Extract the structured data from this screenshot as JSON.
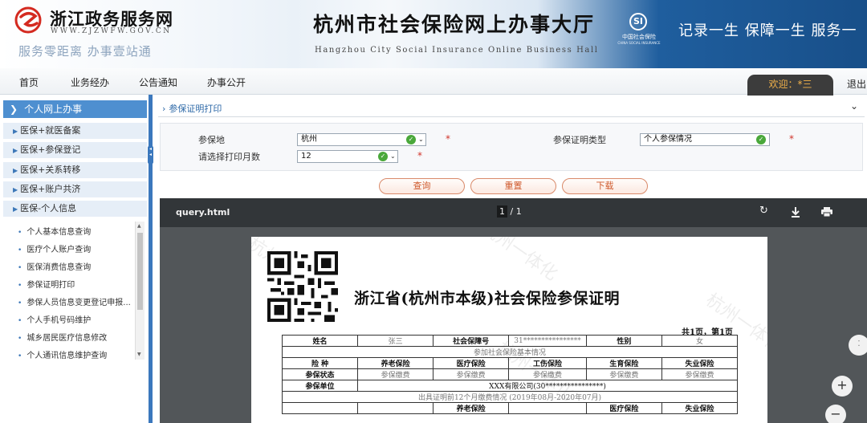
{
  "header": {
    "site_name": "浙江政务服务网",
    "site_url": "WWW.ZJZWFW.GOV.CN",
    "slogan": "服务零距离 办事壹站通",
    "title": "杭州市社会保险网上办事大厅",
    "subtitle": "Hangzhou City Social Insurance Online Business Hall",
    "si_logo_text": "中国社会保险",
    "si_logo_en": "CHINA SOCIAL INSURANCE",
    "motto": "记录一生 保障一生 服务一"
  },
  "nav": {
    "items": [
      "首页",
      "业务经办",
      "公告通知",
      "办事公开"
    ],
    "welcome": "欢迎：*三",
    "logout": "退出>"
  },
  "sidebar": {
    "head": "个人网上办事",
    "groups": [
      "医保+就医备案",
      "医保+参保登记",
      "医保+关系转移",
      "医保+账户共济",
      "医保-个人信息"
    ],
    "subitems": [
      "个人基本信息查询",
      "医疗个人账户查询",
      "医保消费信息查询",
      "参保证明打印",
      "参保人员信息变更登记申报...",
      "个人手机号码维护",
      "城乡居民医疗信息修改",
      "个人通讯信息维护查询"
    ]
  },
  "breadcrumb": "参保证明打印",
  "form": {
    "region_label": "参保地",
    "region_value": "杭州",
    "type_label": "参保证明类型",
    "type_value": "个人参保情况",
    "months_label": "请选择打印月数",
    "months_value": "12",
    "required_mark": "*"
  },
  "buttons": {
    "query": "查询",
    "reset": "重置",
    "download": "下载"
  },
  "viewer": {
    "file_name": "query.html",
    "page_current": "1",
    "page_total": "/ 1"
  },
  "document": {
    "title": "浙江省(杭州市本级)社会保险参保证明",
    "page_info": "共1页，第1页",
    "watermark": "杭州一体化",
    "row1": {
      "name_label": "姓名",
      "name_value": "张三",
      "ssn_label": "社会保障号",
      "ssn_value": "31****************",
      "gender_label": "性别",
      "gender_value": "女"
    },
    "basic_info_header": "参加社会保险基本情况",
    "insurance_header": "险 种",
    "insurance_types": [
      "养老保险",
      "医疗保险",
      "工伤保险",
      "生育保险",
      "失业保险"
    ],
    "status_label": "参保状态",
    "status_values": [
      "参保缴费",
      "参保缴费",
      "参保缴费",
      "参保缴费",
      "参保缴费"
    ],
    "unit_label": "参保单位",
    "unit_value": "XXX有限公司(30****************)",
    "payment_header": "出具证明前12个月缴费情况 (2019年08月-2020年07月)",
    "payment_cols": [
      "养老保险",
      "医疗保险",
      "失业保险"
    ]
  },
  "colors": {
    "sidebar_head": "#4e8fd0",
    "splitter": "#3b78bd",
    "button_text": "#cf5a2d",
    "required": "#d0352b",
    "viewer_bg": "#525659",
    "viewer_toolbar": "#323639"
  }
}
